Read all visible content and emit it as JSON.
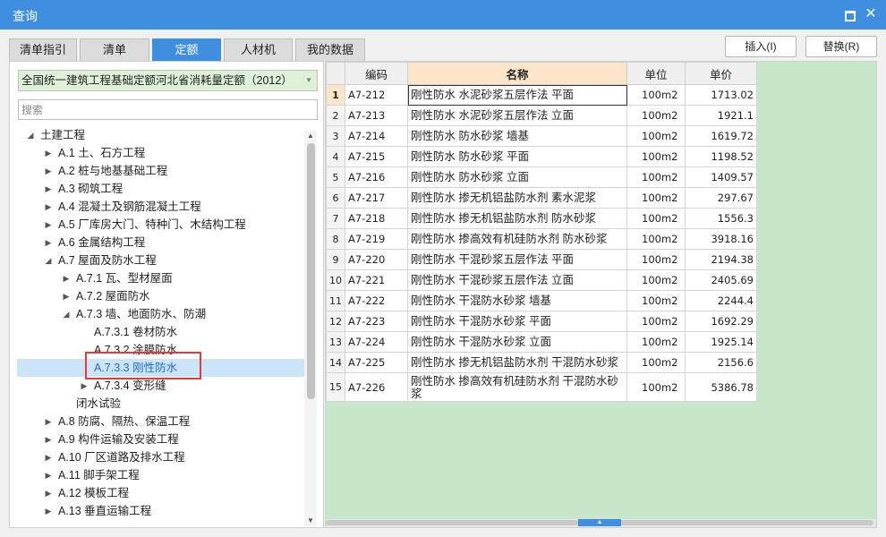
{
  "window": {
    "title": "查询"
  },
  "tabs": [
    {
      "label": "清单指引",
      "active": false
    },
    {
      "label": "清单",
      "active": false
    },
    {
      "label": "定额",
      "active": true
    },
    {
      "label": "人材机",
      "active": false
    },
    {
      "label": "我的数据",
      "active": false
    }
  ],
  "actions": {
    "insert": "插入(I)",
    "replace": "替换(R)"
  },
  "library": {
    "selected": "全国统一建筑工程基础定额河北省消耗量定额（2012）"
  },
  "search": {
    "placeholder": "搜索"
  },
  "tree": [
    {
      "label": "土建工程",
      "level": 0,
      "state": "expanded"
    },
    {
      "label": "A.1 土、石方工程",
      "level": 1,
      "state": "collapsed"
    },
    {
      "label": "A.2 桩与地基基础工程",
      "level": 1,
      "state": "collapsed"
    },
    {
      "label": "A.3 砌筑工程",
      "level": 1,
      "state": "collapsed"
    },
    {
      "label": "A.4 混凝土及钢筋混凝土工程",
      "level": 1,
      "state": "collapsed"
    },
    {
      "label": "A.5 厂库房大门、特种门、木结构工程",
      "level": 1,
      "state": "collapsed"
    },
    {
      "label": "A.6 金属结构工程",
      "level": 1,
      "state": "collapsed"
    },
    {
      "label": "A.7 屋面及防水工程",
      "level": 1,
      "state": "expanded"
    },
    {
      "label": "A.7.1 瓦、型材屋面",
      "level": 2,
      "state": "collapsed"
    },
    {
      "label": "A.7.2 屋面防水",
      "level": 2,
      "state": "collapsed"
    },
    {
      "label": "A.7.3 墙、地面防水、防潮",
      "level": 2,
      "state": "expanded"
    },
    {
      "label": "A.7.3.1 卷材防水",
      "level": 3,
      "state": "leaf"
    },
    {
      "label": "A.7.3.2 涂膜防水",
      "level": 3,
      "state": "leaf"
    },
    {
      "label": "A.7.3.3 刚性防水",
      "level": 3,
      "state": "leaf",
      "selected": true
    },
    {
      "label": "A.7.3.4 变形缝",
      "level": 3,
      "state": "collapsed"
    },
    {
      "label": "闭水试验",
      "level": 2,
      "state": "leaf"
    },
    {
      "label": "A.8 防腐、隔热、保温工程",
      "level": 1,
      "state": "collapsed"
    },
    {
      "label": "A.9 构件运输及安装工程",
      "level": 1,
      "state": "collapsed"
    },
    {
      "label": "A.10 厂区道路及排水工程",
      "level": 1,
      "state": "collapsed"
    },
    {
      "label": "A.11 脚手架工程",
      "level": 1,
      "state": "collapsed"
    },
    {
      "label": "A.12 模板工程",
      "level": 1,
      "state": "collapsed"
    },
    {
      "label": "A.13 垂直运输工程",
      "level": 1,
      "state": "collapsed"
    }
  ],
  "grid": {
    "headers": {
      "code": "编码",
      "name": "名称",
      "unit": "单位",
      "price": "单价"
    },
    "rows": [
      {
        "no": "1",
        "code": "A7-212",
        "name": "刚性防水 水泥砂浆五层作法 平面",
        "unit": "100m2",
        "price": "1713.02"
      },
      {
        "no": "2",
        "code": "A7-213",
        "name": "刚性防水 水泥砂浆五层作法 立面",
        "unit": "100m2",
        "price": "1921.1"
      },
      {
        "no": "3",
        "code": "A7-214",
        "name": "刚性防水 防水砂浆 墙基",
        "unit": "100m2",
        "price": "1619.72"
      },
      {
        "no": "4",
        "code": "A7-215",
        "name": "刚性防水 防水砂浆 平面",
        "unit": "100m2",
        "price": "1198.52"
      },
      {
        "no": "5",
        "code": "A7-216",
        "name": "刚性防水 防水砂浆 立面",
        "unit": "100m2",
        "price": "1409.57"
      },
      {
        "no": "6",
        "code": "A7-217",
        "name": "刚性防水 掺无机铝盐防水剂 素水泥浆",
        "unit": "100m2",
        "price": "297.67"
      },
      {
        "no": "7",
        "code": "A7-218",
        "name": "刚性防水 掺无机铝盐防水剂 防水砂浆",
        "unit": "100m2",
        "price": "1556.3"
      },
      {
        "no": "8",
        "code": "A7-219",
        "name": "刚性防水 掺高效有机硅防水剂 防水砂浆",
        "unit": "100m2",
        "price": "3918.16"
      },
      {
        "no": "9",
        "code": "A7-220",
        "name": "刚性防水 干混砂浆五层作法 平面",
        "unit": "100m2",
        "price": "2194.38"
      },
      {
        "no": "10",
        "code": "A7-221",
        "name": "刚性防水 干混砂浆五层作法 立面",
        "unit": "100m2",
        "price": "2405.69"
      },
      {
        "no": "11",
        "code": "A7-222",
        "name": "刚性防水 干混防水砂浆 墙基",
        "unit": "100m2",
        "price": "2244.4"
      },
      {
        "no": "12",
        "code": "A7-223",
        "name": "刚性防水 干混防水砂浆 平面",
        "unit": "100m2",
        "price": "1692.29"
      },
      {
        "no": "13",
        "code": "A7-224",
        "name": "刚性防水 干混防水砂浆 立面",
        "unit": "100m2",
        "price": "1925.14"
      },
      {
        "no": "14",
        "code": "A7-225",
        "name": "刚性防水 掺无机铝盐防水剂 干混防水砂浆",
        "unit": "100m2",
        "price": "2156.6"
      },
      {
        "no": "15",
        "code": "A7-226",
        "name": "刚性防水 掺高效有机硅防水剂 干混防水砂浆",
        "unit": "100m2",
        "price": "5386.78"
      }
    ]
  },
  "colors": {
    "accent": "#3f8fe0",
    "selection": "#cce4f7",
    "highlight": "#e53935",
    "empty_area": "#c8e6c9",
    "header_active": "#fce5c8"
  }
}
